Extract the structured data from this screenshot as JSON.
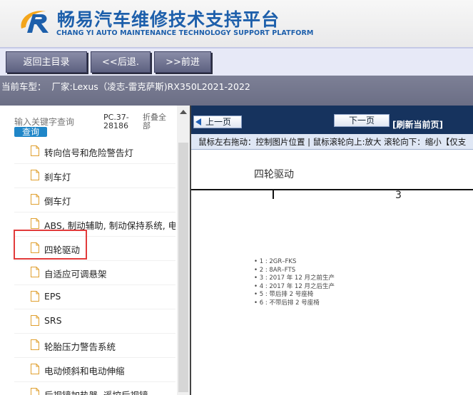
{
  "header": {
    "title_cn": "畅易汽车维修技术支持平台",
    "title_en": "CHANG YI AUTO MAINTENANCE TECHNOLOGY SUPPORT PLATFORM",
    "brand_color": "#1d5fab"
  },
  "nav": {
    "home_label": "返回主目录",
    "back_label": "<<后退.",
    "forward_label": ">>前进"
  },
  "vehicle": {
    "label": "当前车型：",
    "value": "厂家:Lexus（凌志-雷克萨斯)RX350L2021-2022"
  },
  "sidebar": {
    "search_placeholder": "输入关键字查询",
    "search_button": "查询",
    "code": "PC.37-28186",
    "collapse": "折叠全部",
    "items": [
      {
        "label": "转向信号和危险警告灯"
      },
      {
        "label": "刹车灯"
      },
      {
        "label": "倒车灯"
      },
      {
        "label": "ABS, 制动辅助, 制动保持系统, 电"
      },
      {
        "label": "四轮驱动"
      },
      {
        "label": "自适应可调悬架"
      },
      {
        "label": "EPS"
      },
      {
        "label": "SRS"
      },
      {
        "label": "轮胎压力警告系统"
      },
      {
        "label": "电动倾斜和电动伸缩"
      },
      {
        "label": "后视镜加热器, 遥控后视镜"
      }
    ],
    "selected_index": 4,
    "highlight_color": "#e23b3b"
  },
  "viewer": {
    "prev_label": "上一页",
    "next_label": "下一页",
    "refresh_label": "[刷新当前页]",
    "hint": "鼠标左右拖动：控制图片位置 | 鼠标滚轮向上:放大  滚轮向下：缩小【仅支",
    "doc_title": "四轮驱动",
    "doc_number": "3",
    "legend": [
      "• 1 : 2GR–FKS",
      "• 2 : 8AR–FTS",
      "• 3 : 2017 年 12 月之前生产",
      "• 4 : 2017 年 12 月之后生产",
      "• 5 : 带后排 2 号座椅",
      "• 6 : 不带后排 2 号座椅"
    ]
  }
}
